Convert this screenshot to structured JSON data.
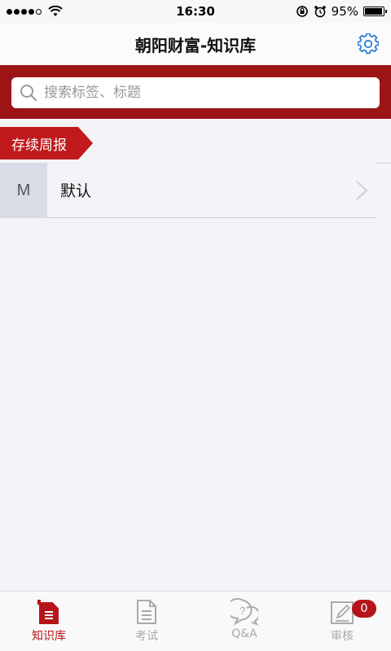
{
  "status_bar": {
    "time": "16:30",
    "battery": "95%",
    "battery_level": 0.95
  },
  "header": {
    "title": "朝阳财富-知识库",
    "settings_icon": "gear-icon",
    "accent_color": "#2a7fd4"
  },
  "search": {
    "placeholder": "搜索标签、标题",
    "band_color": "#9c1416"
  },
  "section": {
    "label": "存续周报",
    "color": "#c01a1c"
  },
  "list": {
    "items": [
      {
        "avatar": "M",
        "label": "默认"
      }
    ]
  },
  "tabs": [
    {
      "label": "知识库",
      "icon": "document-icon",
      "active": true
    },
    {
      "label": "考试",
      "icon": "exam-icon",
      "active": false
    },
    {
      "label": "Q&A",
      "icon": "question-bubble-icon",
      "active": false
    },
    {
      "label": "审核",
      "icon": "review-pen-icon",
      "active": false,
      "badge": "0"
    }
  ],
  "colors": {
    "brand": "#b5151a",
    "inactive_tab": "#aaaaaa"
  }
}
